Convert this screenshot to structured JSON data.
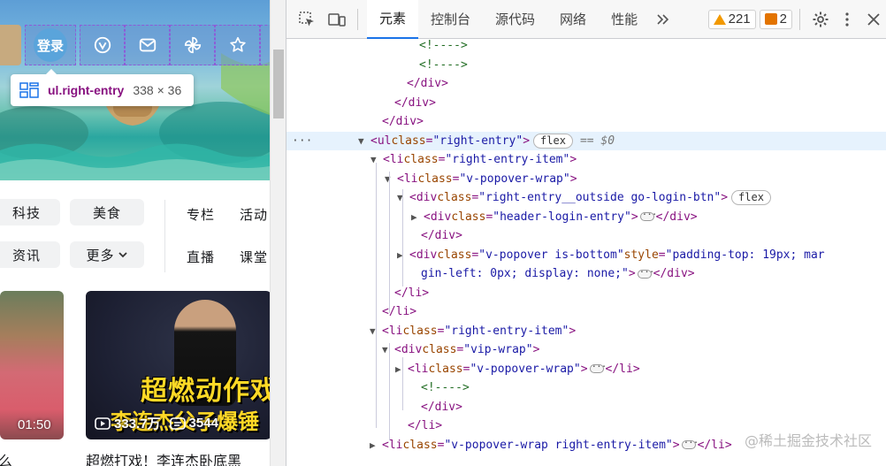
{
  "page": {
    "login_label": "登录",
    "hint": {
      "tag": "ul.right-entry",
      "size": "338 × 36"
    },
    "channels": {
      "pill_1": "科技",
      "pill_2": "美食",
      "pill_3": "资讯",
      "pill_4": "更多",
      "plain_1": "专栏",
      "plain_2": "活动",
      "plain_3": "直播",
      "plain_4": "课堂"
    },
    "cards": [
      {
        "duration": "01:50",
        "title": "么"
      },
      {
        "views": "333.7万",
        "danmaku": "3544",
        "overlay_1": "超燃动作戏",
        "overlay_2": "李连杰父子爆锤",
        "title": "超燃打戏！李连杰卧底黑"
      }
    ]
  },
  "devtools": {
    "tabs": [
      "元素",
      "控制台",
      "源代码",
      "网络",
      "性能"
    ],
    "warnings": "221",
    "issues": "2",
    "lines": [
      {
        "text": "<!---->",
        "kind": "comment"
      },
      {
        "text": "<!---->",
        "kind": "comment"
      },
      {
        "text": "</div>",
        "kind": "close"
      },
      {
        "text": "</div>",
        "kind": "close"
      },
      {
        "text": "</div>",
        "kind": "close"
      },
      {
        "tag": "ul",
        "class": "right-entry",
        "pill": "flex",
        "eq": "== $0",
        "kind": "open"
      },
      {
        "tag": "li",
        "class": "right-entry-item",
        "kind": "open"
      },
      {
        "tag": "li",
        "class": "v-popover-wrap",
        "kind": "open"
      },
      {
        "tag": "div",
        "class": "right-entry__outside go-login-btn",
        "pill": "flex",
        "kind": "open"
      },
      {
        "tag": "div",
        "class": "header-login-entry",
        "kind": "collapsed",
        "close": "</div>"
      },
      {
        "text": "</div>",
        "kind": "close"
      },
      {
        "tag": "div",
        "class": "v-popover is-bottom",
        "style": "padding-top: 19px; mar",
        "kind": "collapsed-style"
      },
      {
        "text": "gin-left: 0px; display: none;",
        "kind": "wrap",
        "close": "</div>"
      },
      {
        "text": "</li>",
        "kind": "close"
      },
      {
        "text": "</li>",
        "kind": "close"
      },
      {
        "tag": "li",
        "class": "right-entry-item",
        "kind": "open"
      },
      {
        "tag": "div",
        "class": "vip-wrap",
        "kind": "open"
      },
      {
        "tag": "li",
        "class": "v-popover-wrap",
        "kind": "collapsed",
        "close": "</li>"
      },
      {
        "text": "<!---->",
        "kind": "comment"
      },
      {
        "text": "</div>",
        "kind": "close"
      },
      {
        "text": "</li>",
        "kind": "close"
      },
      {
        "tag": "li",
        "class": "v-popover-wrap right-entry-item",
        "kind": "collapsed",
        "close": "</li>"
      }
    ],
    "watermark": "@稀土掘金技术社区"
  }
}
